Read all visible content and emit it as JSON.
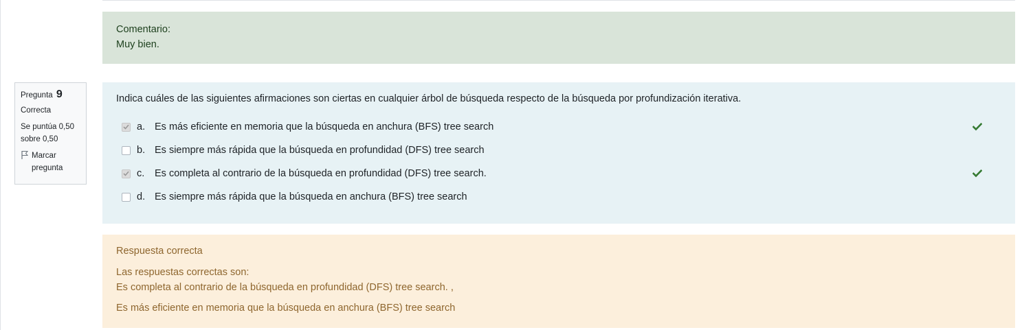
{
  "comment": {
    "label": "Comentario:",
    "text": "Muy bien."
  },
  "question_info": {
    "question_label": "Pregunta",
    "question_number": "9",
    "state": "Correcta",
    "grade_line1": "Se puntúa 0,50",
    "grade_line2": "sobre 0,50",
    "flag_label_line1": "Marcar",
    "flag_label_line2": "pregunta"
  },
  "question": {
    "text": "Indica cuáles de las siguientes afirmaciones son ciertas en cualquier árbol de búsqueda respecto de la búsqueda por profundización iterativa.",
    "answers": [
      {
        "letter": "a.",
        "text": "Es más eficiente en memoria que la búsqueda en anchura (BFS) tree search",
        "checked": true,
        "correct": true
      },
      {
        "letter": "b.",
        "text": "Es siempre más rápida que la búsqueda en profundidad (DFS) tree search",
        "checked": false,
        "correct": false
      },
      {
        "letter": "c.",
        "text": "Es completa al contrario de la búsqueda en profundidad (DFS) tree search.",
        "checked": true,
        "correct": true
      },
      {
        "letter": "d.",
        "text": "Es siempre más rápida que la búsqueda en anchura (BFS) tree search",
        "checked": false,
        "correct": false
      }
    ]
  },
  "feedback": {
    "title": "Respuesta correcta",
    "intro": "Las respuestas correctas son:",
    "answer1": "Es completa al contrario de la búsqueda en profundidad (DFS) tree search. ,",
    "answer2": "Es más eficiente en memoria que la búsqueda en anchura (BFS) tree search"
  },
  "colors": {
    "comment_bg": "#d9e4d9",
    "question_bg": "#e7f2f5",
    "feedback_bg": "#fcefdc",
    "feedback_text": "#8e662e",
    "correct_tick": "#357a32"
  },
  "icons": {
    "flag": "flag-icon",
    "correct": "check-icon"
  }
}
